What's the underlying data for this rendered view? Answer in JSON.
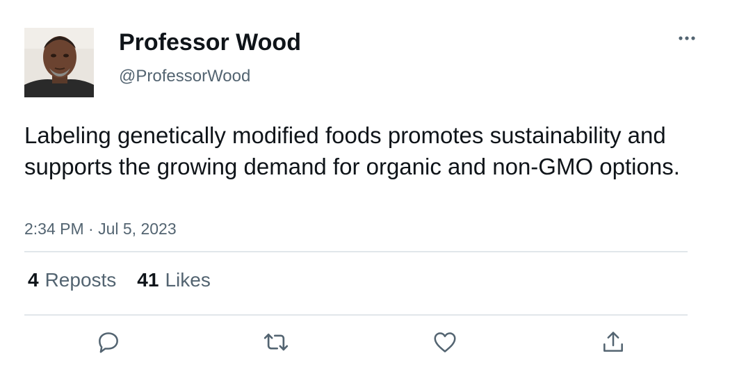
{
  "tweet": {
    "display_name": "Professor Wood",
    "handle": "@ProfessorWood",
    "text": "Labeling genetically modified foods promotes sustainability and supports the growing demand for organic and non-GMO options.",
    "timestamp": "2:34 PM · Jul 5, 2023"
  },
  "stats": {
    "reposts_count": "4",
    "reposts_label": "Reposts",
    "likes_count": "41",
    "likes_label": "Likes"
  },
  "icons": {
    "more": "more-horizontal-icon",
    "reply": "reply-icon",
    "repost": "repost-icon",
    "like": "heart-icon",
    "share": "share-icon"
  },
  "colors": {
    "text_primary": "#0f1419",
    "text_secondary": "#536471",
    "divider": "#e1e6ea"
  }
}
